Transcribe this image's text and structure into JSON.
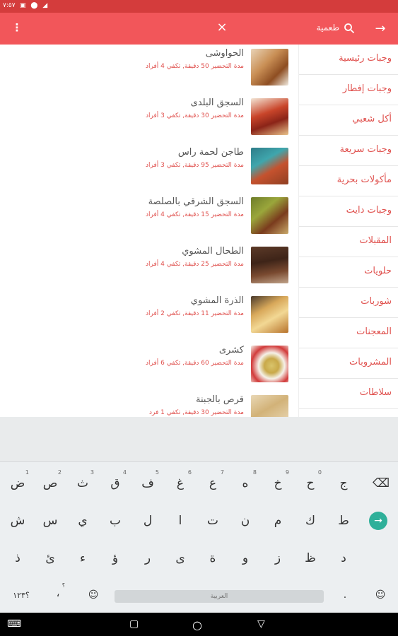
{
  "status_bar": {
    "time": "٧:٥٧",
    "icons": "▣ ⬤ ◢"
  },
  "toolbar": {
    "info_icon": "info-vertical-dots",
    "clear_icon": "×",
    "search_label": "طعمية",
    "search_icon": "search-icon",
    "back_icon": "→"
  },
  "recipes": [
    {
      "title": "الحواوشى",
      "meta": "مدة التحضير 50 دقيقة, تكفي 4 أفراد"
    },
    {
      "title": "السجق البلدى",
      "meta": "مدة التحضير 30 دقيقة, تكفي 3 أفراد"
    },
    {
      "title": "طاجن لحمة راس",
      "meta": "مدة التحضير 95 دقيقة, تكفي 3 أفراد"
    },
    {
      "title": "السجق الشرقي بالصلصة",
      "meta": "مدة التحضير 15 دقيقة, تكفي 4 أفراد"
    },
    {
      "title": "الطحال المشوي",
      "meta": "مدة التحضير 25 دقيقة, تكفي 4 أفراد"
    },
    {
      "title": "الذرة المشوي",
      "meta": "مدة التحضير 11 دقيقة, تكفي 2 أفراد"
    },
    {
      "title": "كشرى",
      "meta": "مدة التحضير 60 دقيقة, تكفي 6 أفراد"
    },
    {
      "title": "قرص بالجبنة",
      "meta": "مدة التحضير 30 دقيقة, تكفي 1 فرد"
    }
  ],
  "categories": [
    "وجبات رئيسية",
    "وجبات إفطار",
    "أكل شعبي",
    "وجبات سريعة",
    "مأكولات بحرية",
    "وجبات دايت",
    "المقبلات",
    "حلويات",
    "شوربات",
    "المعجنات",
    "المشروبات",
    "سلاطات"
  ],
  "keyboard": {
    "row1": [
      {
        "k": "ج",
        "h": ""
      },
      {
        "k": "ح",
        "h": "0"
      },
      {
        "k": "خ",
        "h": "9"
      },
      {
        "k": "ه",
        "h": "8"
      },
      {
        "k": "ع",
        "h": "7"
      },
      {
        "k": "غ",
        "h": "6"
      },
      {
        "k": "ف",
        "h": "5"
      },
      {
        "k": "ق",
        "h": "4"
      },
      {
        "k": "ث",
        "h": "3"
      },
      {
        "k": "ص",
        "h": "2"
      },
      {
        "k": "ض",
        "h": "1"
      }
    ],
    "row2": [
      "ط",
      "ك",
      "م",
      "ن",
      "ت",
      "ا",
      "ل",
      "ب",
      "ي",
      "س",
      "ش"
    ],
    "row3": [
      "د",
      "ظ",
      "ز",
      "و",
      "ة",
      "ى",
      "ر",
      "ؤ",
      "ء",
      "ئ",
      "ذ"
    ],
    "backspace": "⌫",
    "enter": "→",
    "numbers_key": "؟١٢٣",
    "comma_key": "،",
    "comma_hint": "؟",
    "emoji_key": "☺",
    "period_key": ".",
    "smiley_key": "☺",
    "space_label": "العربية"
  },
  "nav": {
    "recents": "▢",
    "home": "○",
    "back": "▽",
    "keyboard": "⌨"
  },
  "colors": {
    "primary": "#f2565a",
    "status": "#d43c3c",
    "accent_text": "#e0524f",
    "enter": "#2fb09a"
  }
}
